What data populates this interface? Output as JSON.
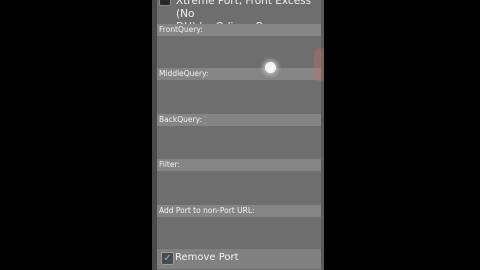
{
  "header": {
    "line1": "Xtreme Port, Front Excess (No",
    "line2": "DH) by Odiseo Onze"
  },
  "fields": {
    "front_query": "FrontQuery:",
    "middle_query": "MiddleQuery:",
    "back_query": "BackQuery:",
    "filter": "Filter:",
    "add_port": "Add Port to non-Port URL:"
  },
  "options": {
    "remove_port": "Remove Port",
    "remove_port_checked": true
  },
  "colors": {
    "background": "#6e6e6e",
    "label_bar": "#858585",
    "checkbox_accent": "#6fb7ff"
  }
}
